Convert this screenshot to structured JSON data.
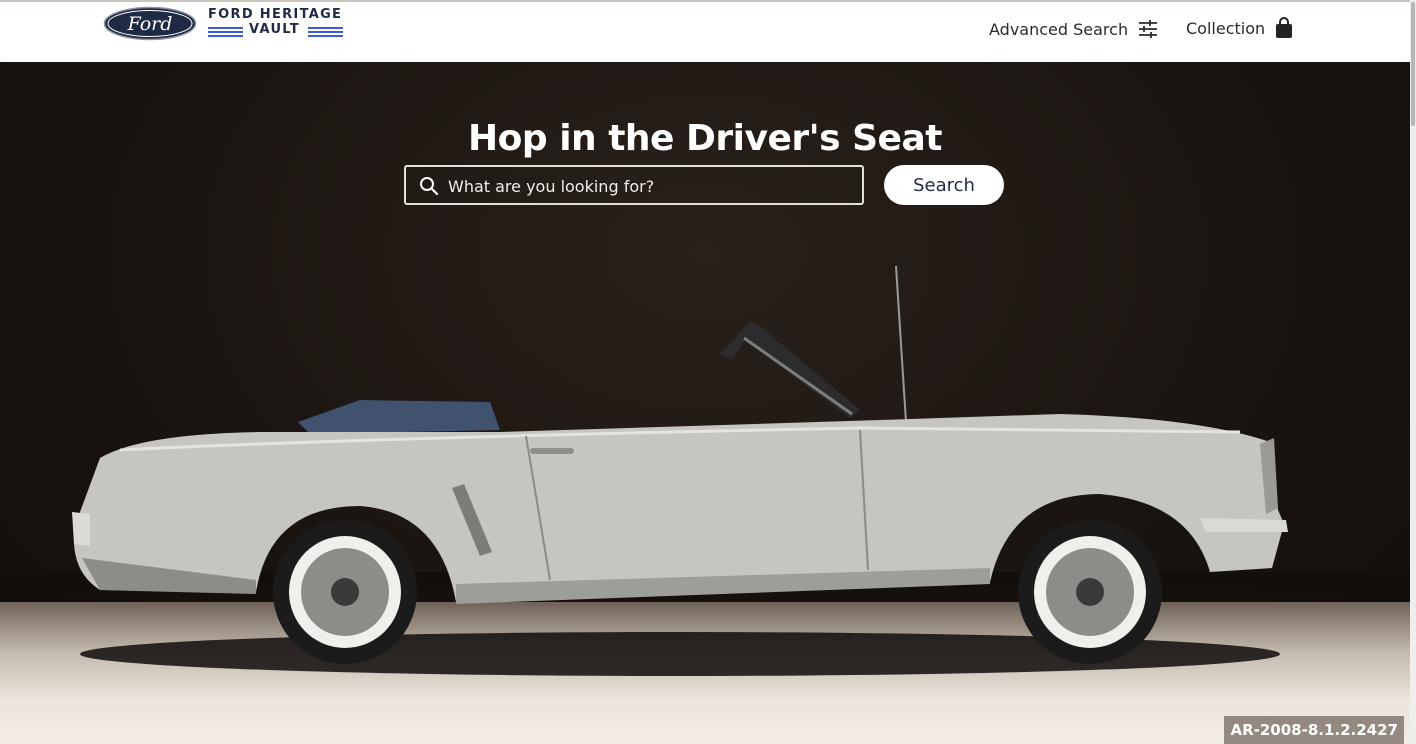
{
  "header": {
    "logo_text": "Ford",
    "brand_line1": "FORD HERITAGE",
    "brand_line2": "VAULT",
    "nav": {
      "advanced_search": "Advanced Search",
      "collection": "Collection"
    },
    "icons": {
      "advanced_search": "sliders-icon",
      "collection": "shopping-bag-icon"
    }
  },
  "hero": {
    "title": "Hop in the Driver's Seat",
    "search": {
      "placeholder": "What are you looking for?",
      "value": "",
      "icon": "search-icon",
      "button_label": "Search"
    },
    "image_caption": "AR-2008-8.1.2.2427"
  },
  "colors": {
    "ford_blue": "#1f2a44",
    "accent_stripe": "#3b5bd9",
    "hero_bg": "#1a1410",
    "button_bg": "#ffffff"
  }
}
